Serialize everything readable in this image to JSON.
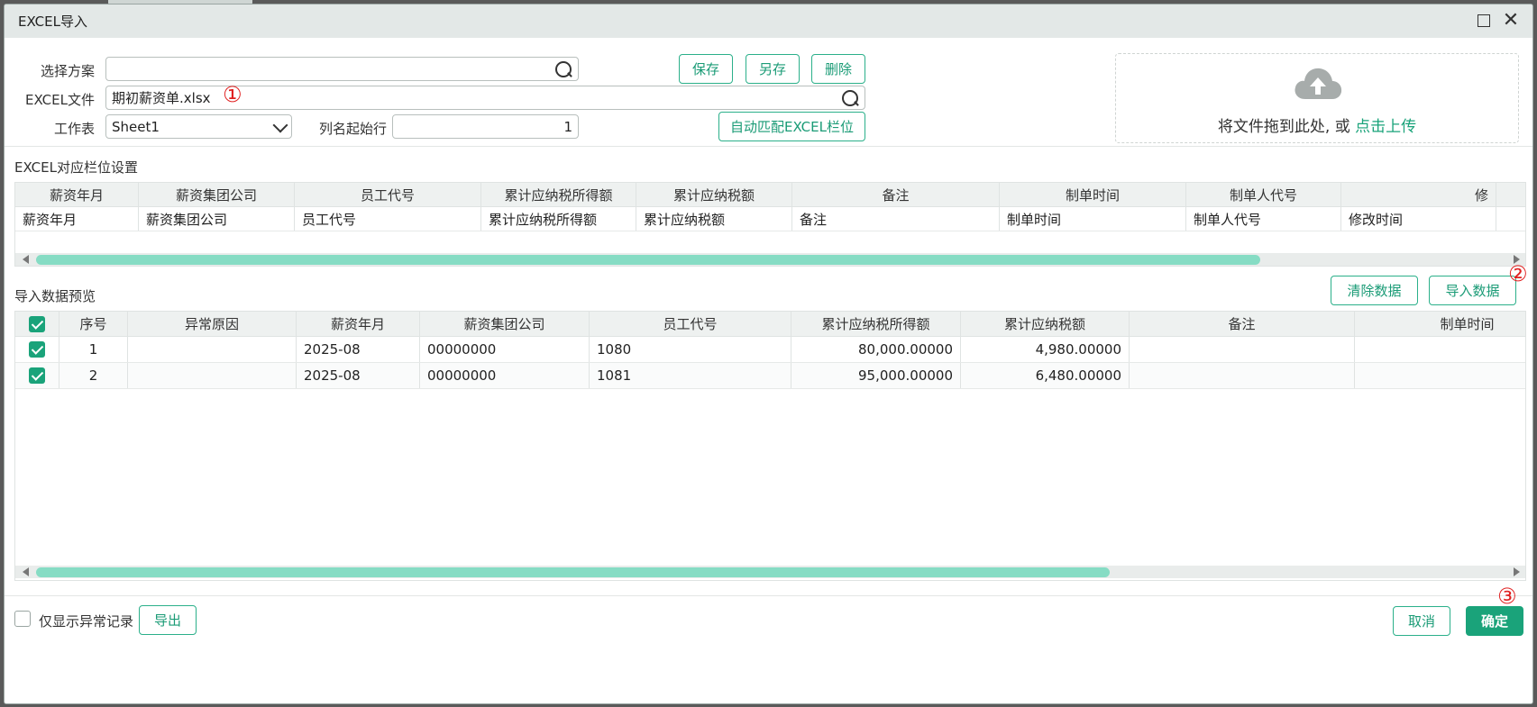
{
  "window": {
    "title": "EXCEL导入"
  },
  "form": {
    "scheme_label": "选择方案",
    "scheme_value": "",
    "excel_file_label": "EXCEL文件",
    "excel_file_value": "期初薪资单.xlsx",
    "sheet_label": "工作表",
    "sheet_value": "Sheet1",
    "start_row_label": "列名起始行",
    "start_row_value": "1"
  },
  "buttons": {
    "save": "保存",
    "save_as": "另存",
    "delete": "删除",
    "auto_match": "自动匹配EXCEL栏位",
    "clear_data": "清除数据",
    "import_data": "导入数据",
    "export": "导出",
    "cancel": "取消",
    "confirm": "确定"
  },
  "markers": {
    "one": "①",
    "two": "②",
    "three": "③"
  },
  "upload": {
    "text": "将文件拖到此处, 或 ",
    "link": "点击上传",
    "icon": "cloud-upload-icon"
  },
  "mapping": {
    "section_label": "EXCEL对应栏位设置",
    "headers": [
      "薪资年月",
      "薪资集团公司",
      "员工代号",
      "累计应纳税所得额",
      "累计应纳税额",
      "备注",
      "制单时间",
      "制单人代号",
      "修"
    ],
    "row": [
      "薪资年月",
      "薪资集团公司",
      "员工代号",
      "累计应纳税所得额",
      "累计应纳税额",
      "备注",
      "制单时间",
      "制单人代号",
      "修改时间"
    ]
  },
  "preview": {
    "section_label": "导入数据预览",
    "headers": [
      "序号",
      "异常原因",
      "薪资年月",
      "薪资集团公司",
      "员工代号",
      "累计应纳税所得额",
      "累计应纳税额",
      "备注",
      "制单时间"
    ],
    "rows": [
      [
        "1",
        "",
        "2025-08",
        "00000000",
        "1080",
        "80,000.00000",
        "4,980.00000",
        "",
        ""
      ],
      [
        "2",
        "",
        "2025-08",
        "00000000",
        "1081",
        "95,000.00000",
        "6,480.00000",
        "",
        ""
      ]
    ]
  },
  "footer": {
    "only_abnormal_label": "仅显示异常记录"
  },
  "colors": {
    "accent": "#1aa37a",
    "marker": "#e02020",
    "scroll_thumb": "#86dcc4"
  }
}
